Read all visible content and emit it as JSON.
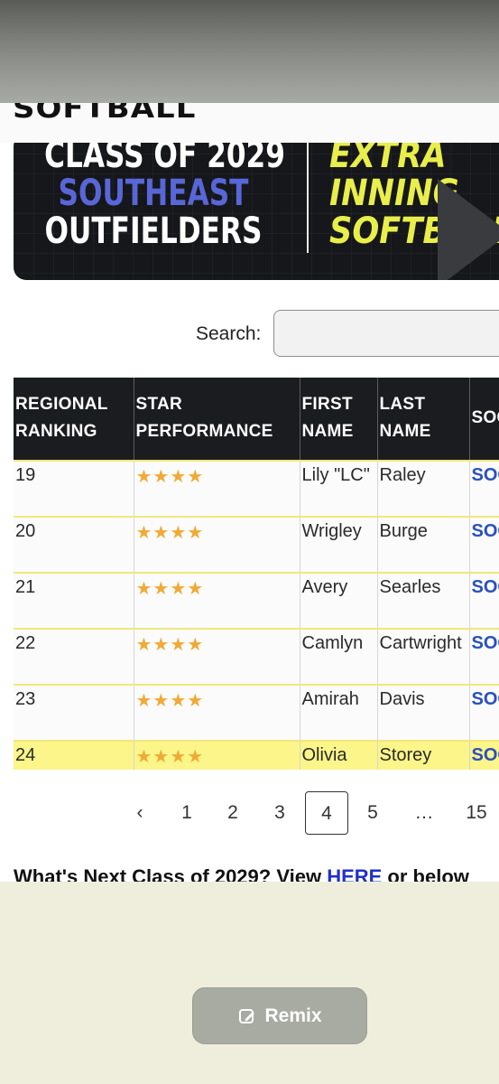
{
  "site": {
    "brand": "SOFTBALL"
  },
  "banner": {
    "line1": "CLASS OF 2029",
    "line2": "SOUTHEAST",
    "line3": "OUTFIELDERS",
    "right1": "EXTRA",
    "right2": "INNING",
    "right3": "SOFTBALL"
  },
  "search": {
    "label": "Search:",
    "value": "",
    "placeholder": ""
  },
  "table": {
    "headers": [
      "REGIONAL RANKING",
      "STAR PERFORMANCE",
      "FIRST NAME",
      "LAST NAME",
      "SOCIAL"
    ],
    "rows": [
      {
        "rank": "19",
        "stars": "★★★★",
        "first": "Lily \"LC\"",
        "last": "Raley",
        "social": "SOCIAL"
      },
      {
        "rank": "20",
        "stars": "★★★★",
        "first": "Wrigley",
        "last": "Burge",
        "social": "SOCIAL"
      },
      {
        "rank": "21",
        "stars": "★★★★",
        "first": "Avery",
        "last": "Searles",
        "social": "SOCIAL"
      },
      {
        "rank": "22",
        "stars": "★★★★",
        "first": "Camlyn",
        "last": "Cartwright",
        "social": "SOCIAL"
      },
      {
        "rank": "23",
        "stars": "★★★★",
        "first": "Amirah",
        "last": "Davis",
        "social": "SOCIAL"
      },
      {
        "rank": "24",
        "stars": "★★★★",
        "first": "Olivia",
        "last": "Storey",
        "social": "SOCIAL"
      }
    ]
  },
  "pagination": {
    "prev": "‹",
    "p1": "1",
    "p2": "2",
    "p3": "3",
    "p4": "4",
    "p5": "5",
    "ellipsis": "…",
    "last": "15",
    "current": "4"
  },
  "next_section": {
    "before": "What's Next Class of 2029? View ",
    "link": "HERE",
    "after": " or below"
  },
  "remix": {
    "label": "Remix",
    "icon": "edit-image-icon"
  },
  "colors": {
    "accent_yellow": "#e8ee4a",
    "accent_blue": "#5866d8",
    "star": "#f0aa36",
    "highlight": "#fbf58a",
    "link": "#2a4fbf"
  }
}
